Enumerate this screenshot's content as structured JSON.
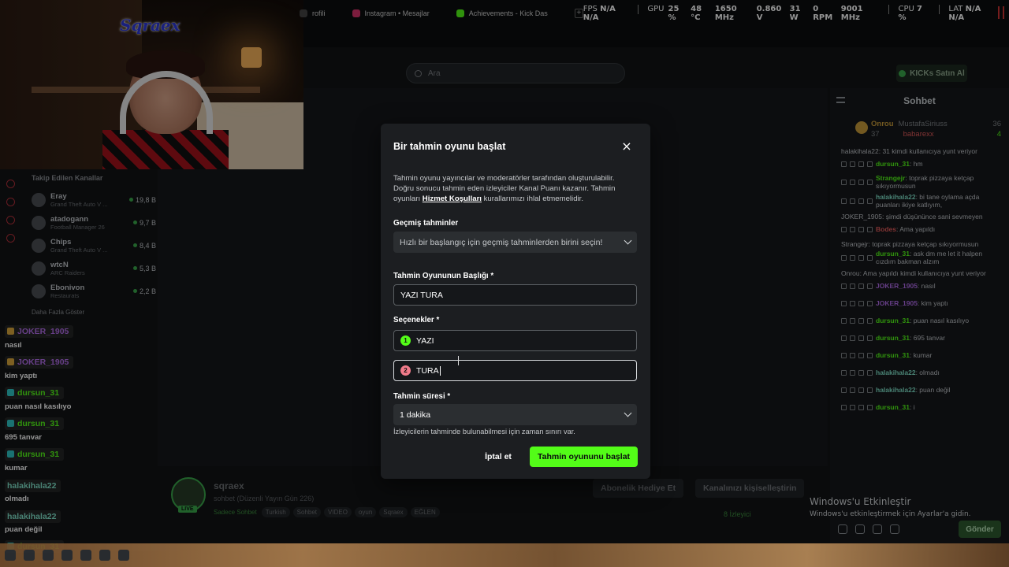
{
  "osd": {
    "tabs": [
      {
        "label": "rofili",
        "color": "#444"
      },
      {
        "label": "Instagram • Mesajlar",
        "color": "#d6336c"
      },
      {
        "label": "Achievements - Kick Das",
        "color": "#53fc18"
      }
    ],
    "plus": "+",
    "fps_label": "FPS",
    "fps_val1": "N/A",
    "fps_val2": "N/A",
    "gpu_label": "GPU",
    "gpu_pct": "25 %",
    "gpu_temp": "48 °C",
    "gpu_clock": "1650 MHz",
    "gpu_volt": "0.860 V",
    "gpu_watt": "31 W",
    "gpu_rpm": "0 RPM",
    "gpu_mem": "9001 MHz",
    "cpu_label": "CPU",
    "cpu_pct": "7 %",
    "lat_label": "LAT",
    "lat_val1": "N/A",
    "lat_val2": "N/A"
  },
  "webcam": {
    "logo_text": "Sqraex"
  },
  "browser": {
    "search_placeholder": "Ara",
    "kicks_button": "KICKs Satın Al"
  },
  "sidebar": {
    "title": "Takip Edilen Kanallar",
    "channels": [
      {
        "name": "Eray",
        "game": "Grand Theft Auto V ...",
        "viewers": "19,8 B"
      },
      {
        "name": "atadogann",
        "game": "Football Manager 26",
        "viewers": "9,7 B"
      },
      {
        "name": "Chips",
        "game": "Grand Theft Auto V ...",
        "viewers": "8,4 B"
      },
      {
        "name": "wtcN",
        "game": "ARC Raiders",
        "viewers": "5,3 B"
      },
      {
        "name": "Ebonivon",
        "game": "Restaurats",
        "viewers": "2,2 B"
      }
    ],
    "more": "Daha Fazla Göster"
  },
  "overlay_chat": [
    {
      "user": "JOKER_1905",
      "color": "#b06be8",
      "badge": "#d8a53c",
      "text": "nasıl"
    },
    {
      "user": "JOKER_1905",
      "color": "#b06be8",
      "badge": "#d8a53c",
      "text": "kim yaptı"
    },
    {
      "user": "dursun_31",
      "color": "#53fc18",
      "badge": "#2ec4c4",
      "text": "puan nasıl kasılıyo"
    },
    {
      "user": "dursun_31",
      "color": "#53fc18",
      "badge": "#2ec4c4",
      "text": "695 tanvar"
    },
    {
      "user": "dursun_31",
      "color": "#53fc18",
      "badge": "#2ec4c4",
      "text": "kumar"
    },
    {
      "user": "halakihala22",
      "color": "#7fe0c8",
      "badge": "",
      "text": "olmadı"
    },
    {
      "user": "halakihala22",
      "color": "#7fe0c8",
      "badge": "",
      "text": "puan değil"
    },
    {
      "user": "dursun_31",
      "color": "#53fc18",
      "badge": "#2ec4c4",
      "text": ""
    }
  ],
  "chat": {
    "title": "Sohbet",
    "leader_left": "Onrou",
    "leader_left_count": "37",
    "leader_user1": "MustafaSiriuss",
    "leader_user1_count": "36",
    "leader_user2": "babarexx",
    "leader_user2_count": "4",
    "messages": [
      {
        "reply": "halakihala22: 31 kimdi kullanıcıya yunt veriyor",
        "user": "dursun_31",
        "color": "#53fc18",
        "text": "hm"
      },
      {
        "reply": "",
        "user": "Strangejr",
        "color": "#53fc18",
        "text": "toprak pizzaya ketçap sıkıyormusun"
      },
      {
        "reply": "",
        "user": "halakihala22",
        "color": "#7fe0c8",
        "text": "bi tane oylama açda puanları ikiye katlıyım,"
      },
      {
        "reply": "JOKER_1905: şimdi düşününce sani sevmeyen",
        "user": "Bodes",
        "color": "#e05a5a",
        "text": "Ama yapıldı"
      },
      {
        "reply": "Strangejr: toprak pizzaya ketçap sıkıyormusun",
        "user": "dursun_31",
        "color": "#53fc18",
        "text": "ask dm me let it halpen cızdım bakman alzım"
      },
      {
        "reply": "Onrou: Ama yapıldı kimdi kullanıcıya yunt veriyor",
        "user": "JOKER_1905",
        "color": "#b06be8",
        "text": "nasıl"
      },
      {
        "reply": "",
        "user": "JOKER_1905",
        "color": "#b06be8",
        "text": "kim yaptı"
      },
      {
        "reply": "",
        "user": "dursun_31",
        "color": "#53fc18",
        "text": "puan nasıl kasılıyo"
      },
      {
        "reply": "",
        "user": "dursun_31",
        "color": "#53fc18",
        "text": "695 tanvar"
      },
      {
        "reply": "",
        "user": "dursun_31",
        "color": "#53fc18",
        "text": "kumar"
      },
      {
        "reply": "",
        "user": "halakihala22",
        "color": "#7fe0c8",
        "text": "olmadı"
      },
      {
        "reply": "",
        "user": "halakihala22",
        "color": "#7fe0c8",
        "text": "puan değil"
      },
      {
        "reply": "",
        "user": "dursun_31",
        "color": "#53fc18",
        "text": "i"
      }
    ],
    "send_label": "Gönder"
  },
  "stream_info": {
    "name": "sqraex",
    "title": "sohbet (Düzenli Yayın Gün 226)",
    "category": "Sadece Sohbet",
    "tags": [
      "Turkish",
      "Sohbet",
      "VIDEO",
      "oyun",
      "Sqraex",
      "EĞLEN"
    ],
    "live": "LIVE",
    "gift_button": "Abonelik Hediye Et",
    "customize_button": "Kanalınızı kişiselleştirin",
    "viewers": "8 İzleyici"
  },
  "windows": {
    "line1": "Windows'u Etkinleştir",
    "line2": "Windows'u etkinleştirmek için Ayarlar'a gidin."
  },
  "modal": {
    "title": "Bir tahmin oyunu başlat",
    "close": "×",
    "desc_before": "Tahmin oyunu yayıncılar ve moderatörler tarafından oluşturulabilir. Doğru sonucu tahmin eden izleyiciler Kanal Puanı kazanır. Tahmin oyunları ",
    "desc_link": "Hizmet Koşulları",
    "desc_after": " kurallarımızı ihlal etmemelidir.",
    "past_label": "Geçmiş tahminler",
    "past_placeholder": "Hızlı bir başlangıç için geçmiş tahminlerden birini seçin!",
    "title_label": "Tahmin Oyununun Başlığı *",
    "title_value": "YAZI TURA",
    "options_label": "Seçenekler *",
    "options": [
      {
        "num": "1",
        "value": "YAZI",
        "color": "#53fc18"
      },
      {
        "num": "2",
        "value": "TURA",
        "color": "#f07b8a"
      }
    ],
    "duration_label": "Tahmin süresi *",
    "duration_value": "1 dakika",
    "hint": "İzleyicilerin tahminde bulunabilmesi için zaman sınırı var.",
    "cancel": "İptal et",
    "start": "Tahmin oyununu başlat"
  }
}
